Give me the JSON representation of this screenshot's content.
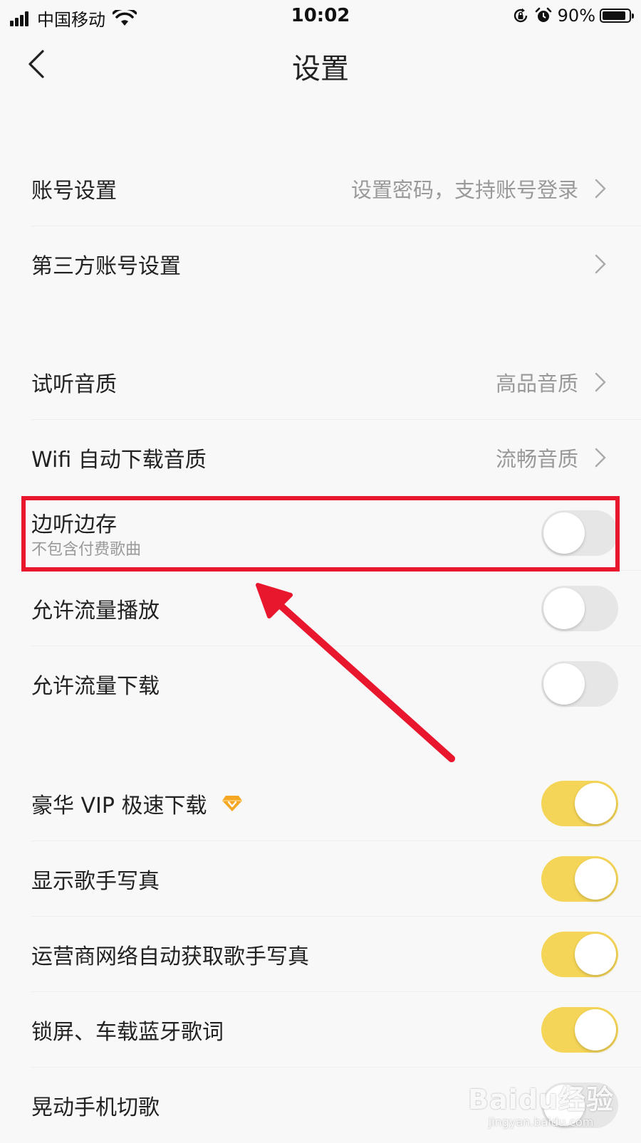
{
  "status_bar": {
    "carrier": "中国移动",
    "time": "10:02",
    "battery": "90%",
    "battery_level": 0.9,
    "icons": [
      "signal-icon",
      "wifi-icon",
      "rotation-lock-icon",
      "alarm-icon",
      "battery-icon"
    ]
  },
  "nav": {
    "title": "设置",
    "back_icon": "chevron-left-icon"
  },
  "settings": {
    "account": {
      "label": "账号设置",
      "value": "设置密码，支持账号登录"
    },
    "third_party": {
      "label": "第三方账号设置"
    },
    "preview_quality": {
      "label": "试听音质",
      "value": "高品音质"
    },
    "wifi_download_quality": {
      "label": "Wifi 自动下载音质",
      "value": "流畅音质"
    },
    "cache_while_listening": {
      "label": "边听边存",
      "sublabel": "不包含付费歌曲",
      "enabled": false
    },
    "allow_data_play": {
      "label": "允许流量播放",
      "enabled": false
    },
    "allow_data_download": {
      "label": "允许流量下载",
      "enabled": false
    },
    "vip_fast_download": {
      "label": "豪华 VIP 极速下载",
      "icon": "vip-diamond-icon",
      "enabled": true
    },
    "show_artist_photo": {
      "label": "显示歌手写真",
      "enabled": true
    },
    "carrier_auto_artist_photo": {
      "label": "运营商网络自动获取歌手写真",
      "enabled": true
    },
    "lockscreen_lyrics": {
      "label": "锁屏、车载蓝牙歌词",
      "enabled": true
    },
    "shake_switch_song": {
      "label": "晃动手机切歌",
      "enabled": false
    }
  },
  "annotation": {
    "highlight_color": "#e8172d",
    "toggle_on_color": "#f4d557"
  },
  "watermark": {
    "logo": "Baidu经验",
    "sub": "jingyan.baidu.com"
  }
}
